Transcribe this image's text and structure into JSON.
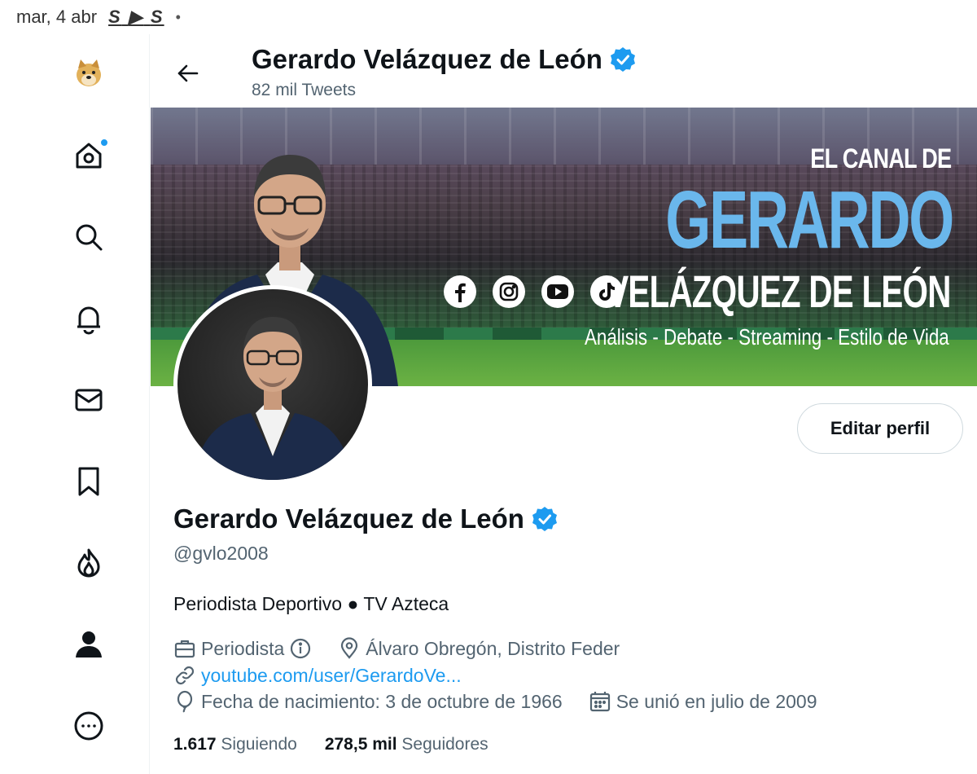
{
  "status_bar": {
    "date": "mar, 4 abr",
    "app_icons": [
      "S",
      "▶",
      "S"
    ],
    "dot": "•"
  },
  "sidebar": {
    "items": [
      {
        "name": "profile-emoji",
        "icon": "doge-avatar"
      },
      {
        "name": "home",
        "icon": "home-icon",
        "has_notification_dot": true
      },
      {
        "name": "explore",
        "icon": "search-icon"
      },
      {
        "name": "notifications",
        "icon": "bell-icon"
      },
      {
        "name": "messages",
        "icon": "mail-icon"
      },
      {
        "name": "bookmarks",
        "icon": "bookmark-icon"
      },
      {
        "name": "trending",
        "icon": "fire-icon"
      },
      {
        "name": "profile",
        "icon": "person-icon"
      },
      {
        "name": "more",
        "icon": "more-icon"
      }
    ]
  },
  "header": {
    "title": "Gerardo Velázquez de León",
    "tweets_count": "82 mil Tweets"
  },
  "banner": {
    "line1": "EL CANAL DE",
    "line2": "GERARDO",
    "line3": "VELÁZQUEZ DE LEÓN",
    "tagline": "Análisis - Debate - Streaming - Estilo de Vida",
    "socials": [
      "facebook-icon",
      "instagram-icon",
      "youtube-icon",
      "tiktok-icon"
    ]
  },
  "actions": {
    "edit_profile": "Editar perfil"
  },
  "profile": {
    "name": "Gerardo Velázquez de León",
    "handle": "@gvlo2008",
    "bio": "Periodista Deportivo ● TV Azteca",
    "profession": "Periodista",
    "location": "Álvaro Obregón, Distrito Feder",
    "url": "youtube.com/user/GerardoVe...",
    "birthday": "Fecha de nacimiento: 3 de octubre de 1966",
    "joined": "Se unió en julio de 2009",
    "following_count": "1.617",
    "following_label": "Siguiendo",
    "followers_count": "278,5 mil",
    "followers_label": "Seguidores"
  },
  "colors": {
    "accent": "#1d9bf0",
    "text": "#0f1419",
    "muted": "#536471",
    "banner_blue": "#6ab7ec"
  }
}
